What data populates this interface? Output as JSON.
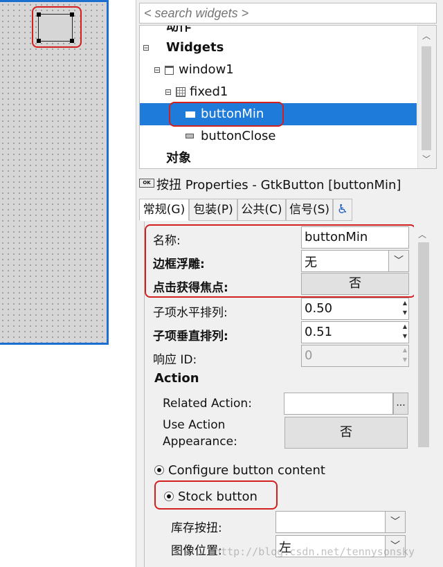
{
  "search": {
    "placeholder": "< search widgets >"
  },
  "tree": {
    "items": [
      {
        "label": "动作",
        "bold": true
      },
      {
        "label": "Widgets",
        "bold": true
      },
      {
        "label": "window1"
      },
      {
        "label": "fixed1"
      },
      {
        "label": "buttonMin",
        "selected": true
      },
      {
        "label": "buttonClose"
      },
      {
        "label": "对象",
        "bold": true
      }
    ]
  },
  "properties_header": {
    "icon_text": "OK",
    "title": "按扭 Properties - GtkButton [buttonMin]"
  },
  "tabs": [
    {
      "label": "常规(G)"
    },
    {
      "label": "包装(P)"
    },
    {
      "label": "公共(C)"
    },
    {
      "label": "信号(S)"
    },
    {
      "label": "accessibility"
    }
  ],
  "props": {
    "name_label": "名称:",
    "name_value": "buttonMin",
    "relief_label": "边框浮雕:",
    "relief_value": "无",
    "focus_on_click_label": "点击获得焦点:",
    "focus_on_click_value": "否",
    "xalign_label": "子项水平排列:",
    "xalign_value": "0.50",
    "yalign_label": "子项垂直排列:",
    "yalign_value": "0.51",
    "response_label": "响应 ID:",
    "response_value": "0",
    "action_header": "Action",
    "related_action_label": "Related Action:",
    "related_action_btn": "...",
    "use_action_label_1": "Use Action",
    "use_action_label_2": "Appearance:",
    "use_action_value": "否",
    "configure_label": "Configure button content",
    "stock_label": "Stock button",
    "stock_id_label": "库存按扭:",
    "image_pos_label": "图像位置:",
    "image_pos_value": "左"
  },
  "watermark": "http://blog.csdn.net/tennysonsky",
  "colors": {
    "selection": "#1e7bd9",
    "highlight": "#d21f1f",
    "canvas_border": "#1b6fd0"
  }
}
